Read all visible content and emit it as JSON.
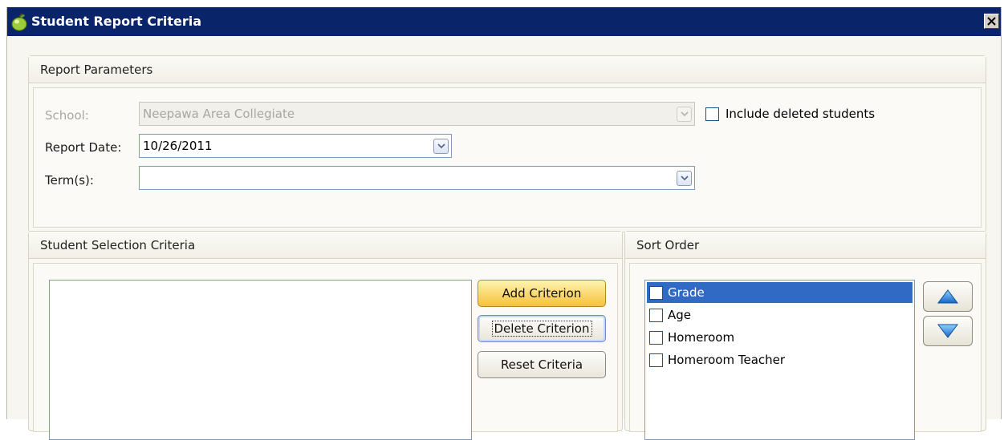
{
  "window": {
    "title": "Student Report Criteria",
    "close_glyph": "✕"
  },
  "report_parameters": {
    "title": "Report Parameters",
    "school_label": "School:",
    "school_value": "Neepawa Area Collegiate",
    "include_deleted_label": "Include deleted students",
    "include_deleted_checked": false,
    "report_date_label": "Report Date:",
    "report_date_value": "10/26/2011",
    "terms_label": "Term(s):",
    "terms_value": ""
  },
  "selection_criteria": {
    "title": "Student Selection Criteria",
    "criteria": [],
    "add_label": "Add Criterion",
    "delete_label": "Delete Criterion",
    "reset_label": "Reset Criteria"
  },
  "sort_order": {
    "title": "Sort Order",
    "items": [
      {
        "label": "Grade",
        "checked": false,
        "selected": true
      },
      {
        "label": "Age",
        "checked": false,
        "selected": false
      },
      {
        "label": "Homeroom",
        "checked": false,
        "selected": false
      },
      {
        "label": "Homeroom Teacher",
        "checked": false,
        "selected": false
      }
    ],
    "move_up_icon": "arrow-up-icon",
    "move_down_icon": "arrow-down-icon"
  },
  "colors": {
    "titlebar": "#0a246a",
    "selection": "#316ac5",
    "hot_button": "#f7c13c",
    "arrow_blue": "#1f8ee0"
  }
}
